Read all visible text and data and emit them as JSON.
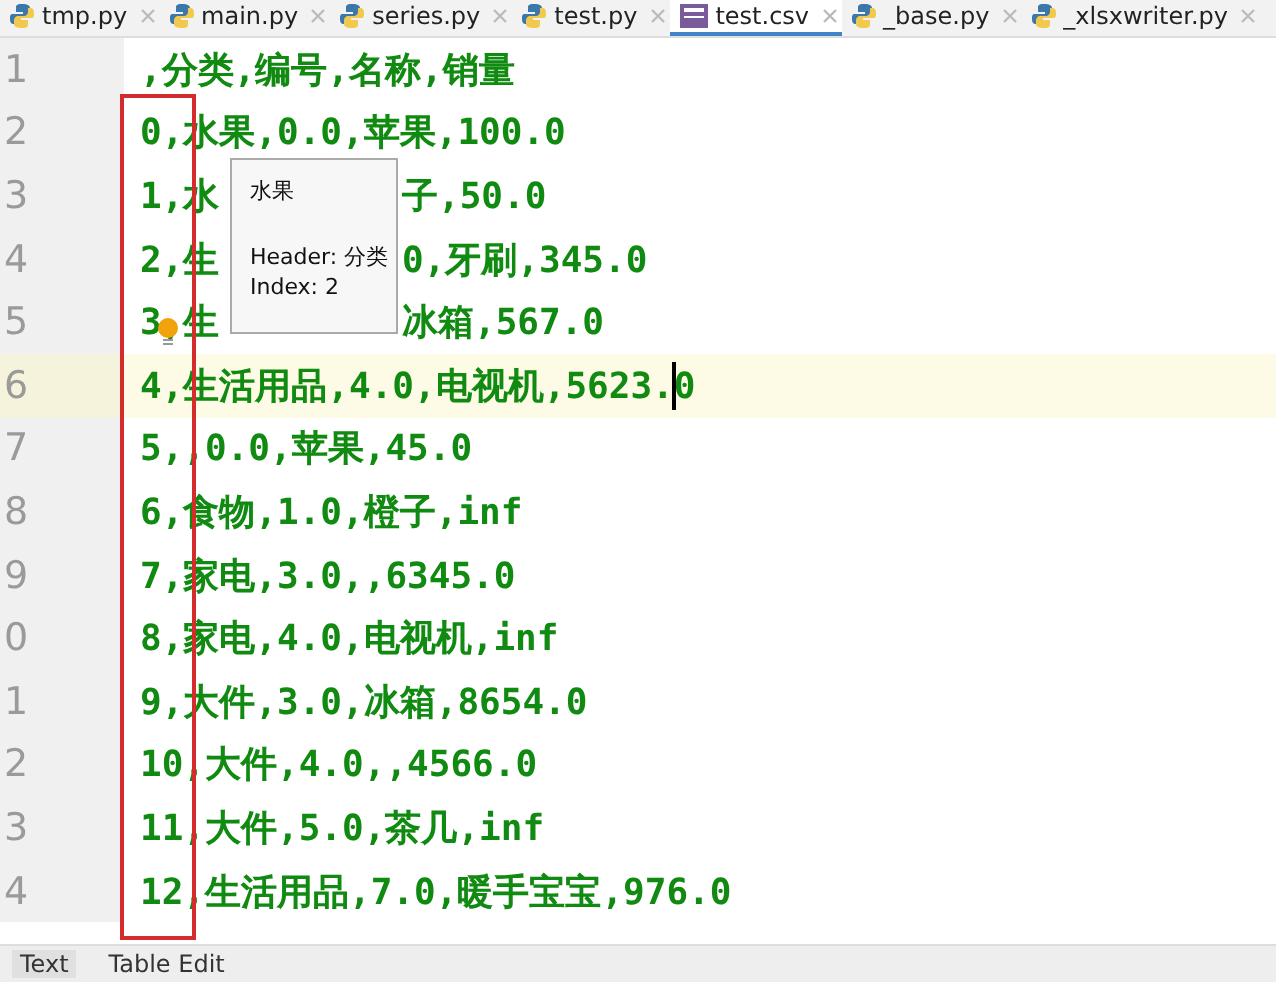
{
  "file_tabs": [
    {
      "label": "tmp.py",
      "kind": "python",
      "selected": false
    },
    {
      "label": "main.py",
      "kind": "python",
      "selected": false
    },
    {
      "label": "series.py",
      "kind": "python",
      "selected": false
    },
    {
      "label": "test.py",
      "kind": "python",
      "selected": false
    },
    {
      "label": "test.csv",
      "kind": "csv",
      "selected": true
    },
    {
      "label": "_base.py",
      "kind": "python",
      "selected": false
    },
    {
      "label": "_xlsxwriter.py",
      "kind": "python",
      "selected": false
    }
  ],
  "editor": {
    "lines": [
      {
        "number": "1",
        "text": ",分类,编号,名称,销量",
        "current": false
      },
      {
        "number": "2",
        "text": "0,水果,0.0,苹果,100.0",
        "current": false
      },
      {
        "number": "3",
        "text": "1,水",
        "text_after_tooltip": "子,50.0",
        "current": false
      },
      {
        "number": "4",
        "text": "2,生",
        "text_after_tooltip": "0,牙刷,345.0",
        "current": false
      },
      {
        "number": "5",
        "text": "3,生",
        "text_after_tooltip": "冰箱,567.0",
        "current": false
      },
      {
        "number": "6",
        "text": "4,生活用品,4.0,电视机,5623.0",
        "current": true
      },
      {
        "number": "7",
        "text": "5,,0.0,苹果,45.0",
        "current": false
      },
      {
        "number": "8",
        "text": "6,食物,1.0,橙子,inf",
        "current": false
      },
      {
        "number": "9",
        "text": "7,家电,3.0,,6345.0",
        "current": false
      },
      {
        "number": "0",
        "text": "8,家电,4.0,电视机,inf",
        "current": false
      },
      {
        "number": "1",
        "text": "9,大件,3.0,冰箱,8654.0",
        "current": false
      },
      {
        "number": "2",
        "text": "10,大件,4.0,,4566.0",
        "current": false
      },
      {
        "number": "3",
        "text": "11,大件,5.0,茶几,inf",
        "current": false
      },
      {
        "number": "4",
        "text": "12,生活用品,7.0,暖手宝宝,976.0",
        "current": false
      }
    ],
    "tooltip": {
      "value": "水果",
      "header": "Header: 分类",
      "index": "Index: 2"
    }
  },
  "bottom_tabs": [
    {
      "label": "Text",
      "selected": true
    },
    {
      "label": "Table Edit",
      "selected": false
    }
  ]
}
